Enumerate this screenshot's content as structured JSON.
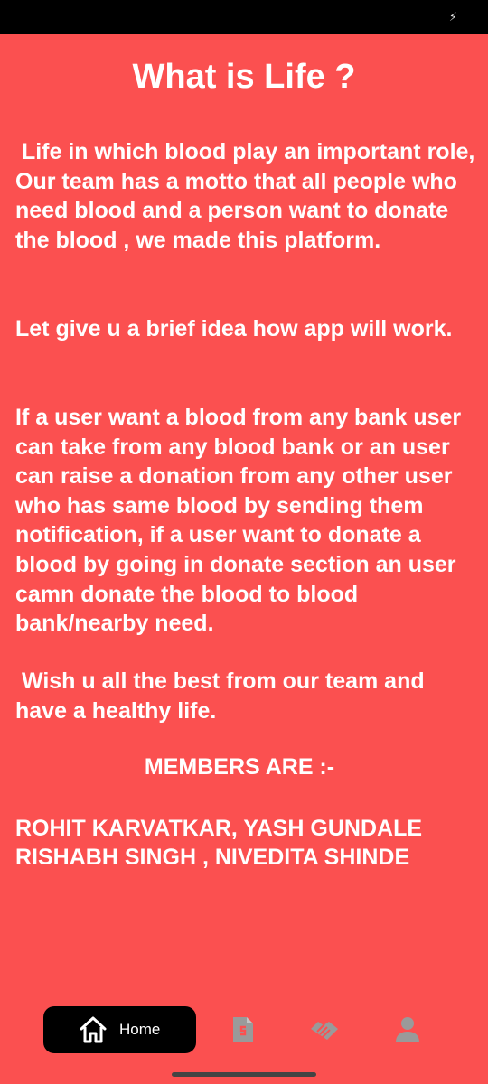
{
  "status_bar": {
    "charging_glyph": "⚡"
  },
  "page": {
    "title": "What is Life ?",
    "paragraph1": " Life in which blood play an important role, Our team has a motto that all people who need blood and a person want to donate the blood , we made this platform.",
    "paragraph2": "Let give u a brief idea how app will work.",
    "paragraph3": "If a user want a blood from any bank user can take from any blood bank or an user can raise a donation from any other user who has same blood by sending them notification, if a user want to donate a blood by going in donate section an user camn donate the blood to blood bank/nearby need.",
    "paragraph4": " Wish u all the best from our team and have a healthy life.",
    "members_heading": "MEMBERS ARE :-",
    "members_line1": "ROHIT KARVATKAR, YASH GUNDALE",
    "members_line2": "RISHABH SINGH , NIVEDITA SHINDE"
  },
  "bottom_nav": {
    "home_label": "Home",
    "icons": [
      "home-icon",
      "blood-document-icon",
      "handshake-icon",
      "profile-icon"
    ]
  },
  "colors": {
    "background": "#fb5050",
    "nav_active_bg": "#000000",
    "nav_inactive_icon": "#9a9a9a",
    "text": "#ffffff"
  }
}
